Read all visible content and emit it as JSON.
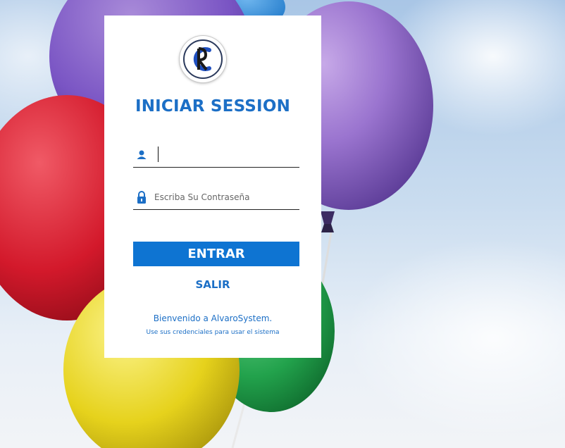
{
  "login": {
    "title": "INICIAR SESSION",
    "username": {
      "value": "",
      "placeholder": "",
      "icon": "user-icon"
    },
    "password": {
      "value": "",
      "placeholder": "Escriba Su Contraseña",
      "icon": "lock-icon"
    },
    "enter_label": "ENTRAR",
    "exit_label": "SALIR",
    "welcome_text": "Bienvenido a AlvaroSystem.",
    "hint_text": "Use sus credenciales  para usar el sistema"
  },
  "colors": {
    "accent": "#1c6fc6",
    "button": "#0e74d2",
    "card": "#ffffff"
  }
}
